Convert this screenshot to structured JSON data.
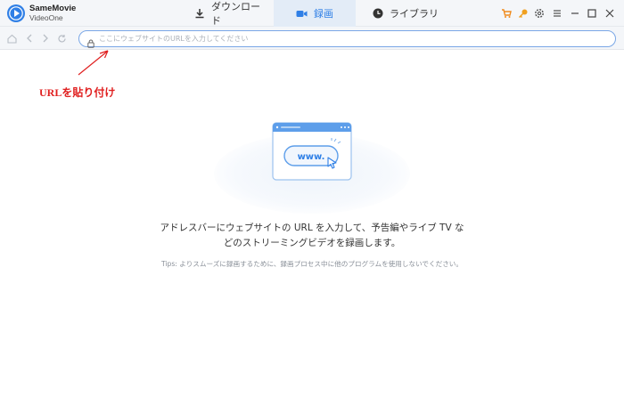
{
  "app": {
    "brand_line1": "SameMovie",
    "brand_line2": "VideoOne"
  },
  "tabs": [
    {
      "label": "ダウンロード",
      "icon": "download-icon"
    },
    {
      "label": "録画",
      "icon": "record-icon",
      "active": true
    },
    {
      "label": "ライブラリ",
      "icon": "clock-icon"
    }
  ],
  "window_controls": [
    "cart-icon",
    "key-icon",
    "gear-icon",
    "menu-icon",
    "minimize-icon",
    "maximize-icon",
    "close-icon"
  ],
  "nav": {
    "buttons": [
      "home-icon",
      "back-icon",
      "forward-icon",
      "reload-icon"
    ],
    "url_placeholder": "ここにウェブサイトのURLを入力してください",
    "url_value": ""
  },
  "annotation": {
    "text": "URLを貼り付け"
  },
  "illustration": {
    "label": "www."
  },
  "main": {
    "message_line1": "アドレスバーにウェブサイトの URL を入力して、予告編やライブ TV な",
    "message_line2": "どのストリーミングビデオを録画します。",
    "tips": "Tips: よりスムーズに録画するために、録画プロセス中に他のプログラムを使用しないでください。"
  },
  "colors": {
    "accent": "#2f7fe6",
    "annotation_red": "#e02020",
    "cart_orange": "#f08a1c",
    "key_orange": "#f0a020"
  }
}
